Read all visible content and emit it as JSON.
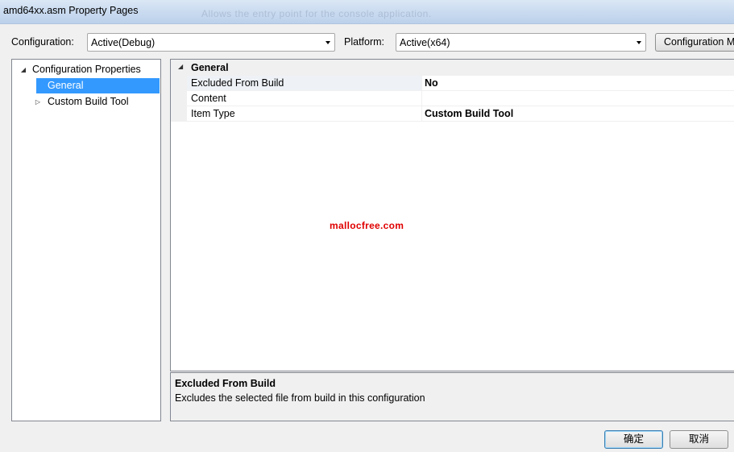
{
  "window": {
    "title": "amd64xx.asm Property Pages",
    "background_text": "Allows the entry point for the console application."
  },
  "toolbar": {
    "configuration_label": "Configuration:",
    "configuration_value": "Active(Debug)",
    "platform_label": "Platform:",
    "platform_value": "Active(x64)",
    "configuration_manager_label": "Configuration Manager..."
  },
  "tree": {
    "items": [
      {
        "label": "Configuration Properties",
        "expanded": true
      },
      {
        "label": "General",
        "selected": true
      },
      {
        "label": "Custom Build Tool",
        "expanded": false
      }
    ]
  },
  "grid": {
    "category": "General",
    "rows": [
      {
        "name": "Excluded From Build",
        "value": "No"
      },
      {
        "name": "Content",
        "value": ""
      },
      {
        "name": "Item Type",
        "value": "Custom Build Tool"
      }
    ]
  },
  "watermark": "mallocfree.com",
  "description": {
    "title": "Excluded From Build",
    "text": "Excludes the selected file from build in this configuration"
  },
  "buttons": {
    "ok": "确定",
    "cancel": "取消"
  },
  "colors": {
    "selection": "#3399ff",
    "watermark": "#e00000"
  }
}
